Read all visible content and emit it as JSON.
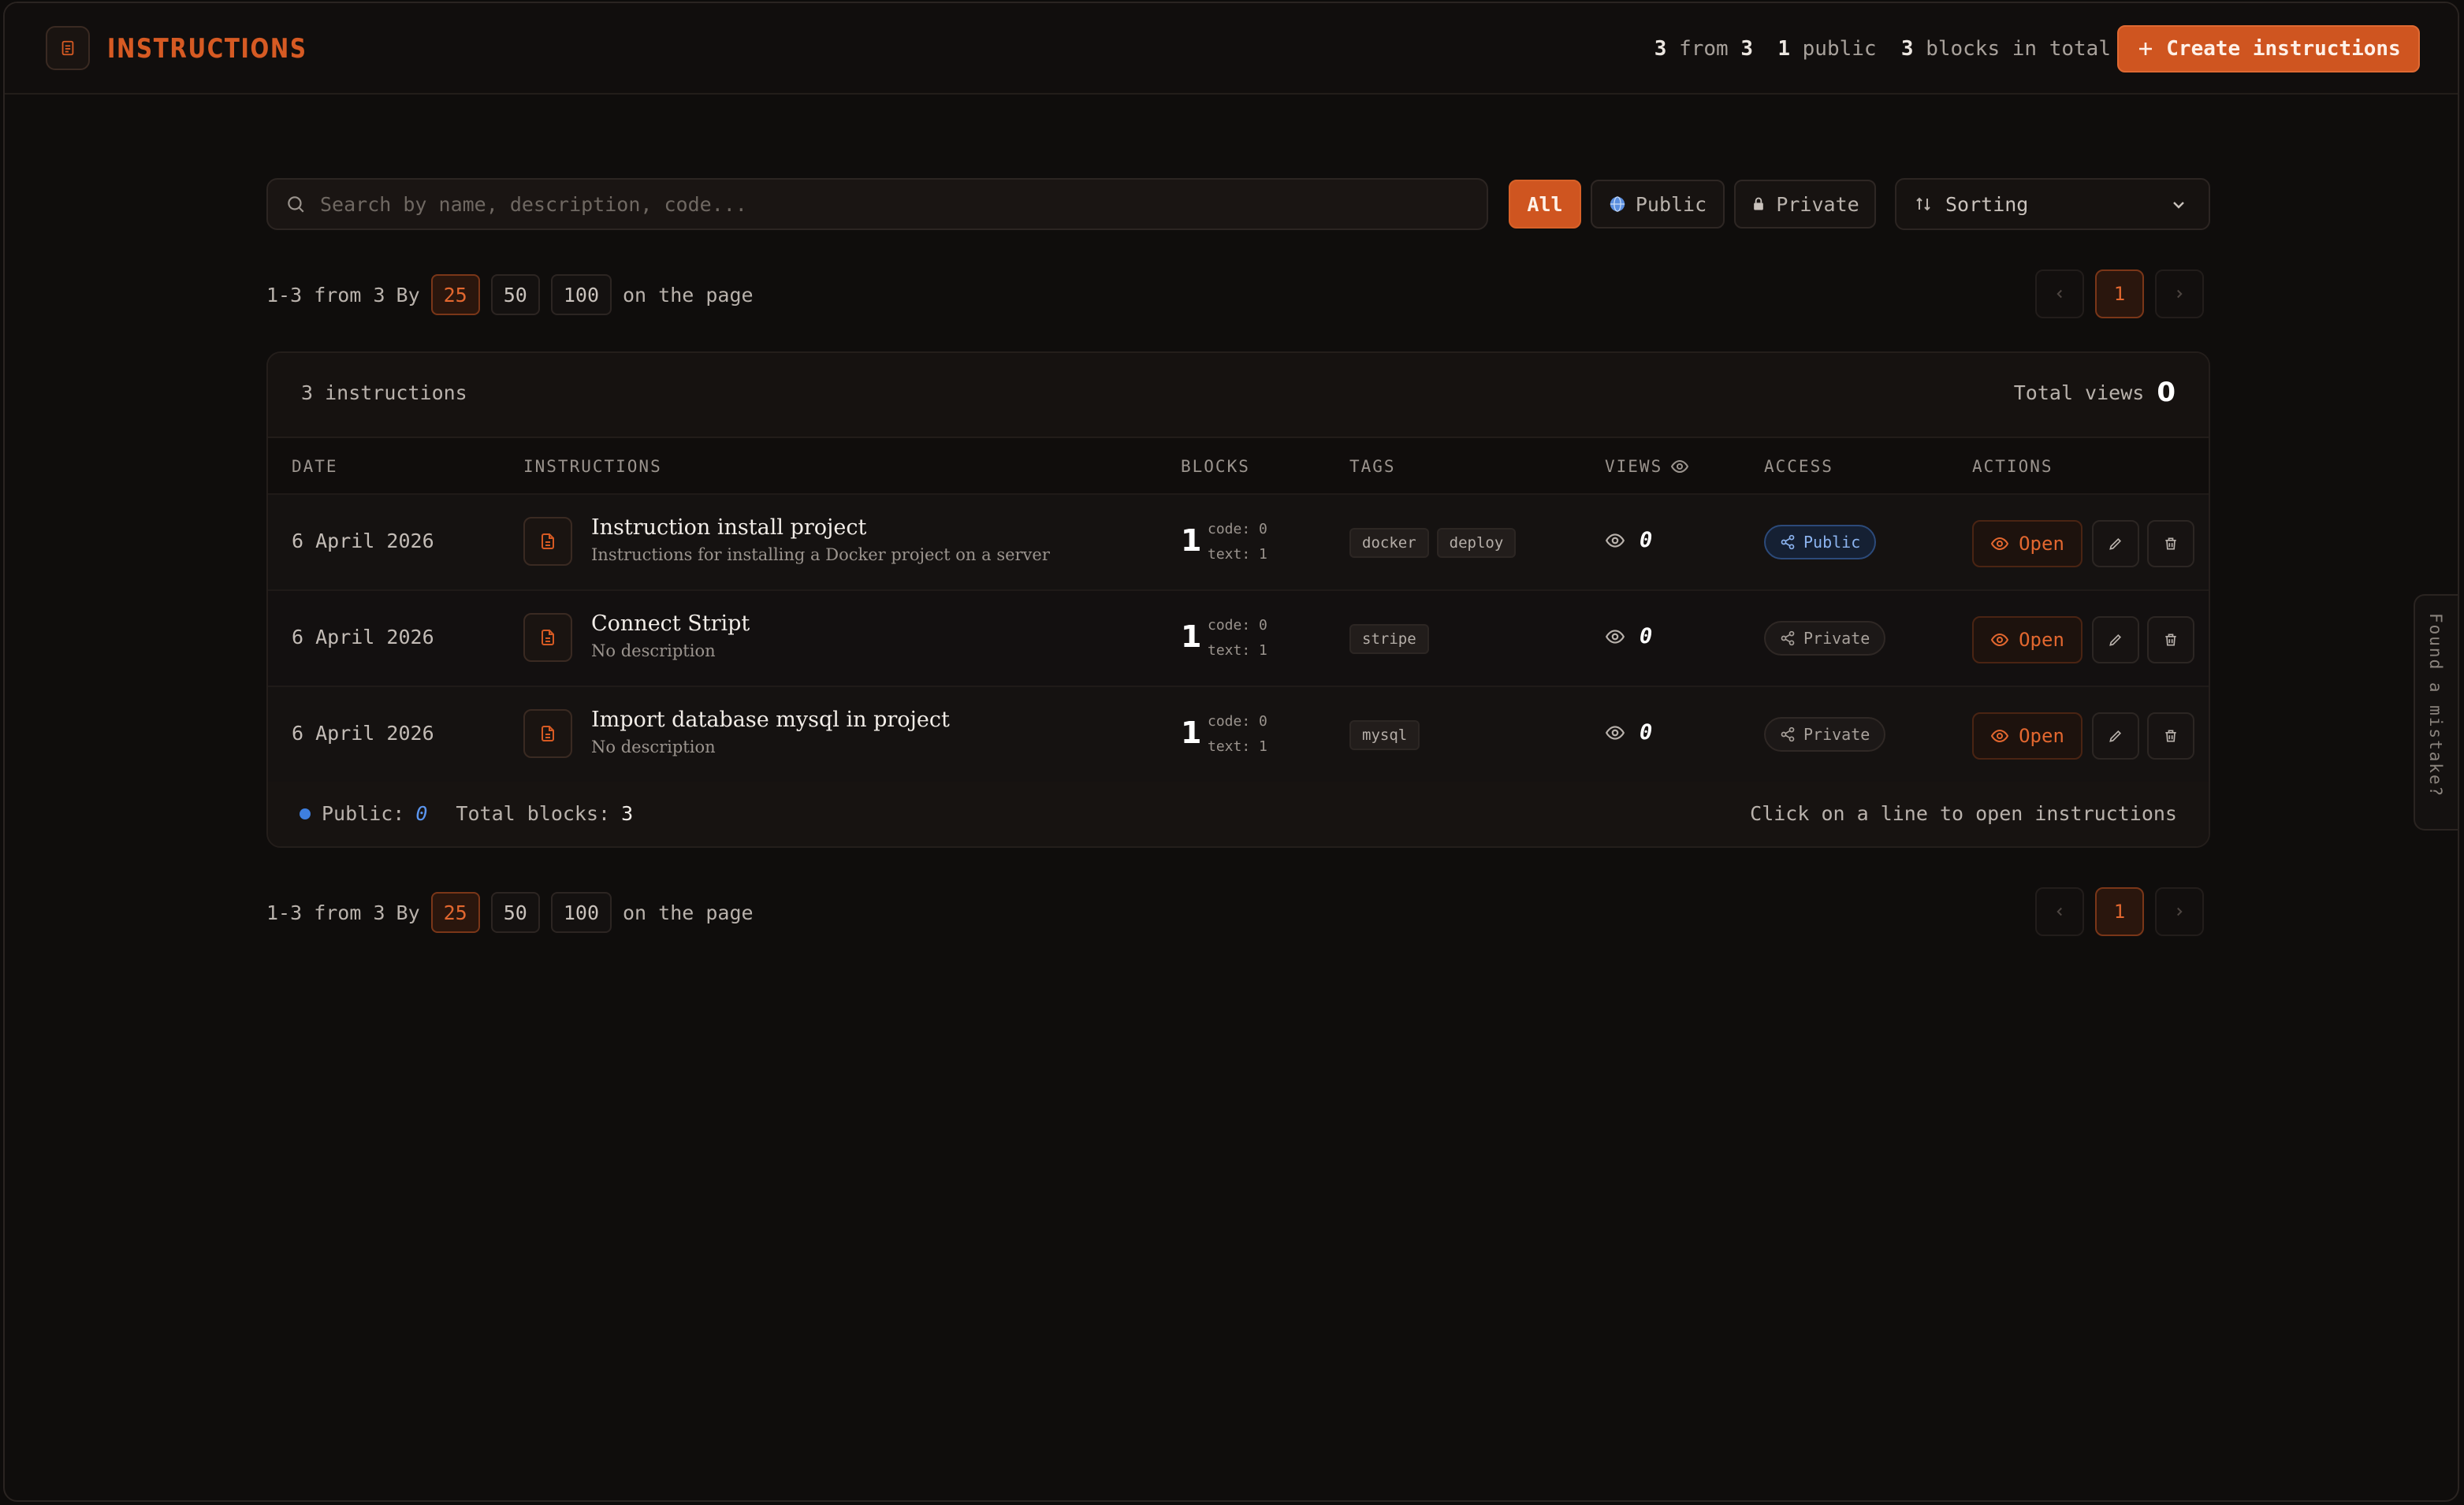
{
  "header": {
    "title": "INSTRUCTIONS",
    "stat_shown": "3",
    "stat_from": "from",
    "stat_total": "3",
    "stat_public_num": "1",
    "stat_public_label": "public",
    "stat_blocks_num": "3",
    "stat_blocks_label": "blocks in total",
    "create_label": "Create instructions"
  },
  "toolbar": {
    "search_placeholder": "Search by name, description, code...",
    "filters": {
      "all": "All",
      "public": "Public",
      "private": "Private"
    },
    "sort_label": "Sorting"
  },
  "pager": {
    "range": "1-3 from 3",
    "by": "By",
    "sizes": [
      "25",
      "50",
      "100"
    ],
    "active_size": "25",
    "suffix": "on the page",
    "current_page": "1"
  },
  "table": {
    "count_label": "3 instructions",
    "total_views_label": "Total views",
    "total_views": "0",
    "columns": {
      "date": "DATE",
      "instructions": "INSTRUCTIONS",
      "blocks": "BLOCKS",
      "tags": "TAGS",
      "views": "VIEWS",
      "access": "ACCESS",
      "actions": "ACTIONS"
    },
    "rows": [
      {
        "date": "6 April 2026",
        "name": "Instruction install project",
        "description": "Instructions for installing a Docker project on a server",
        "blocks": "1",
        "code": "code: 0",
        "text": "text: 1",
        "tags": [
          "docker",
          "deploy"
        ],
        "views": "0",
        "access": "Public",
        "open": "Open"
      },
      {
        "date": "6 April 2026",
        "name": "Connect Stript",
        "description": "No description",
        "blocks": "1",
        "code": "code: 0",
        "text": "text: 1",
        "tags": [
          "stripe"
        ],
        "views": "0",
        "access": "Private",
        "open": "Open"
      },
      {
        "date": "6 April 2026",
        "name": "Import database mysql in project",
        "description": "No description",
        "blocks": "1",
        "code": "code: 0",
        "text": "text: 1",
        "tags": [
          "mysql"
        ],
        "views": "0",
        "access": "Private",
        "open": "Open"
      }
    ],
    "footer": {
      "public_label": "Public:",
      "public_count": "0",
      "blocks_label": "Total blocks:",
      "blocks_count": "3",
      "hint": "Click on a line to open instructions"
    }
  },
  "side_tab": {
    "label": "Found a mistake?"
  },
  "colors": {
    "accent": "#cf5520",
    "public": "#3e7fe0",
    "background": "#0f0d0c"
  }
}
